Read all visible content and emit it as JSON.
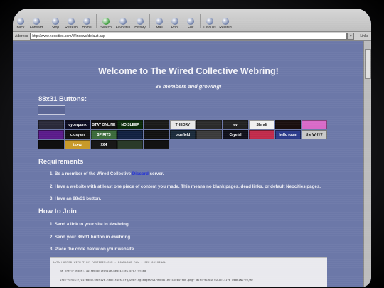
{
  "toolbar": {
    "buttons": [
      "Back",
      "Forward",
      "Stop",
      "Refresh",
      "Home",
      "Search",
      "Favorites",
      "History",
      "Mail",
      "Print",
      "Edit",
      "Discuss",
      "Related"
    ]
  },
  "address": {
    "label": "Address",
    "url": "http://www.neocities.com/Windows/default.asp",
    "links": "Links"
  },
  "page": {
    "title": "Welcome to The Wired Collective Webring!",
    "subtitle": "39 members and growing!",
    "buttons_heading": "88x31 Buttons:",
    "broken_image_alt": "",
    "requirements_heading": "Requirements",
    "requirements": [
      {
        "before": "Be a member of the Wired Collective ",
        "link": "Discord",
        "after": " server."
      },
      {
        "before": "Have a website with at least one piece of content you made. This means no blank pages, dead links, or default Neocities pages.",
        "link": "",
        "after": ""
      },
      {
        "before": "Have an 88x31 button.",
        "link": "",
        "after": ""
      }
    ],
    "join_heading": "How to Join",
    "join_steps": [
      "Send a link to your site in #webring.",
      "Send your 88x31 button in #webring.",
      "Place the code below on your website."
    ],
    "code_caption": "DATA HOSTED WITH ♥ BY PASTEBIN.COM - DOWNLOAD RAW - SEE ORIGINAL",
    "code_line1": "<a href=\"https://wiredcollective.neocities.org/\"><img",
    "code_line2": "src=\"https://wiredcollective.neocities.org/webringimages/wiredcollectivebutton.png\" alt=\"WIRED COLLECTIVE WEBRING\"></a>"
  },
  "badges": [
    {
      "label": "",
      "bg": "#2a2a3a"
    },
    {
      "label": "cyberpunk",
      "bg": "#0c0c20"
    },
    {
      "label": "STAY ONLINE",
      "bg": "#111"
    },
    {
      "label": "NO SLEEP",
      "bg": "#0a2a0a"
    },
    {
      "label": "",
      "bg": "#1a1a1a"
    },
    {
      "label": "THEORY",
      "bg": "#e8e8e8"
    },
    {
      "label": "",
      "bg": "#2b2b2b"
    },
    {
      "label": "ev",
      "bg": "#222"
    },
    {
      "label": "Slendi",
      "bg": "#f0f0f0"
    },
    {
      "label": "",
      "bg": "#1a0f0f"
    },
    {
      "label": "",
      "bg": "#d86ac8"
    },
    {
      "label": "",
      "bg": "#5a1a8a"
    },
    {
      "label": "ciosyam",
      "bg": "#111"
    },
    {
      "label": "SPIRITS",
      "bg": "#3a6a3a"
    },
    {
      "label": "",
      "bg": "#102040"
    },
    {
      "label": "",
      "bg": "#101010"
    },
    {
      "label": "bluefield",
      "bg": "#1a2a3a"
    },
    {
      "label": "",
      "bg": "#3a3a3a"
    },
    {
      "label": "Cryefal",
      "bg": "#0f0f1a"
    },
    {
      "label": "",
      "bg": "#c02a4a"
    },
    {
      "label": "hello room",
      "bg": "#2a3a8a"
    },
    {
      "label": "the WHY?",
      "bg": "#c8c8c8"
    },
    {
      "label": "",
      "bg": "#101010"
    },
    {
      "label": "tsxyz",
      "bg": "#c89a2a"
    },
    {
      "label": "X64",
      "bg": "#181818"
    },
    {
      "label": "",
      "bg": "#2a3a2a"
    },
    {
      "label": "",
      "bg": "#121212"
    }
  ]
}
